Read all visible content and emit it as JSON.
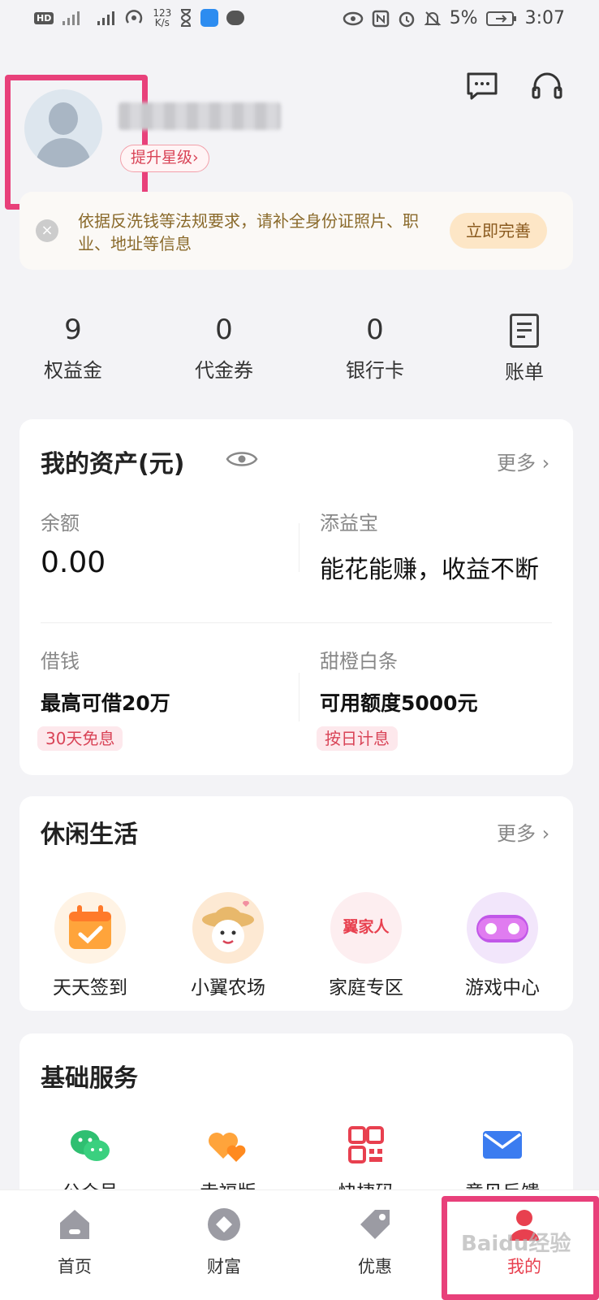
{
  "status_bar": {
    "hd": "HD",
    "net_speed_value": "123",
    "net_speed_unit": "K/s",
    "battery": "5%",
    "time": "3:07"
  },
  "profile": {
    "level_button": "提升星级",
    "level_chevron": "›"
  },
  "notice": {
    "close_glyph": "×",
    "text": "依据反洗钱等法规要求，请补全身份证照片、职业、地址等信息",
    "action": "立即完善"
  },
  "stats": [
    {
      "value": "9",
      "label": "权益金"
    },
    {
      "value": "0",
      "label": "代金券"
    },
    {
      "value": "0",
      "label": "银行卡"
    },
    {
      "label": "账单",
      "icon": "bill-icon"
    }
  ],
  "assets": {
    "title": "我的资产(元)",
    "more": "更多 ›",
    "balance_label": "余额",
    "balance_value": "0.00",
    "fund_label": "添益宝",
    "fund_value": "能花能赚，收益不断",
    "borrow_label": "借钱",
    "borrow_value": "最高可借20万",
    "borrow_tag": "30天免息",
    "credit_label": "甜橙白条",
    "credit_value": "可用额度5000元",
    "credit_tag": "按日计息"
  },
  "leisure": {
    "title": "休闲生活",
    "more": "更多 ›",
    "items": [
      {
        "label": "天天签到",
        "icon": "calendar-check-icon"
      },
      {
        "label": "小翼农场",
        "icon": "farm-mascot-icon"
      },
      {
        "label": "家庭专区",
        "icon": "family-icon",
        "icon_text": "翼家人"
      },
      {
        "label": "游戏中心",
        "icon": "gamepad-icon"
      }
    ]
  },
  "services": {
    "title": "基础服务",
    "items": [
      {
        "label": "公众号",
        "icon": "wechat-icon"
      },
      {
        "label": "幸福版",
        "icon": "hearts-icon"
      },
      {
        "label": "快捷码",
        "icon": "qrcode-icon"
      },
      {
        "label": "意见反馈",
        "icon": "mail-icon"
      }
    ]
  },
  "tabbar": {
    "items": [
      {
        "label": "首页",
        "icon": "home-icon"
      },
      {
        "label": "财富",
        "icon": "wealth-icon"
      },
      {
        "label": "优惠",
        "icon": "tag-icon"
      },
      {
        "label": "我的",
        "icon": "profile-icon",
        "active": true
      }
    ]
  },
  "watermark": "Baidu经验",
  "colors": {
    "highlight": "#e8407a",
    "accent_red": "#d94457",
    "notice_text": "#8a6a2b",
    "notice_button": "#fde6c6"
  }
}
